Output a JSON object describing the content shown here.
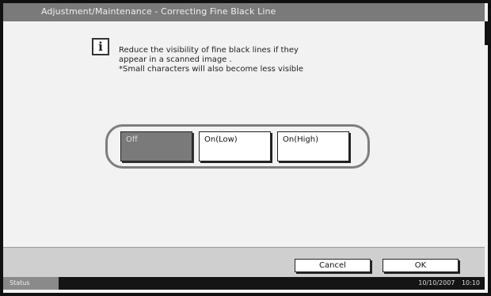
{
  "window": {
    "title": "Adjustment/Maintenance - Correcting Fine Black Line"
  },
  "info": {
    "icon": "info-icon",
    "icon_glyph": "i",
    "lines": [
      "Reduce the visibility of fine black lines if they",
      "appear in a scanned image .",
      "*Small characters will also become less visible"
    ]
  },
  "options": {
    "selected": "Off",
    "items": [
      {
        "label": "Off"
      },
      {
        "label": "On(Low)"
      },
      {
        "label": "On(High)"
      }
    ]
  },
  "footer": {
    "cancel_label": "Cancel",
    "ok_label": "OK"
  },
  "statusbar": {
    "status_label": "Status",
    "date": "10/10/2007",
    "time": "10:10"
  },
  "colors": {
    "titlebar": "#7a7a7a",
    "selected_option": "#7a7a7a",
    "panel": "#f2f2f2",
    "statusbar": "#151515"
  }
}
